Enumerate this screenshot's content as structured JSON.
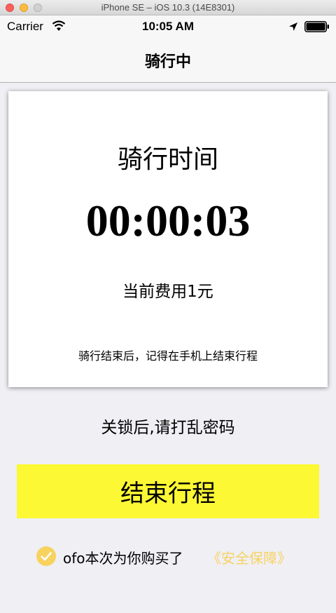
{
  "window": {
    "title": "iPhone SE – iOS 10.3 (14E8301)"
  },
  "status_bar": {
    "carrier": "Carrier",
    "time": "10:05 AM",
    "icons": [
      "wifi-icon",
      "location-arrow-icon",
      "battery-icon"
    ]
  },
  "nav": {
    "title": "骑行中"
  },
  "card": {
    "label": "骑行时间",
    "timer": "00:00:03",
    "fee": "当前费用1元",
    "reminder": "骑行结束后，记得在手机上结束行程"
  },
  "lock_hint": "关锁后,请打乱密码",
  "end_button": {
    "label": "结束行程"
  },
  "insurance": {
    "checked": true,
    "text": "ofo本次为你购买了",
    "link": "《安全保障》"
  },
  "colors": {
    "background": "#efeff4",
    "button_yellow": "#fcf834",
    "accent_yellow": "#f8d25f"
  }
}
